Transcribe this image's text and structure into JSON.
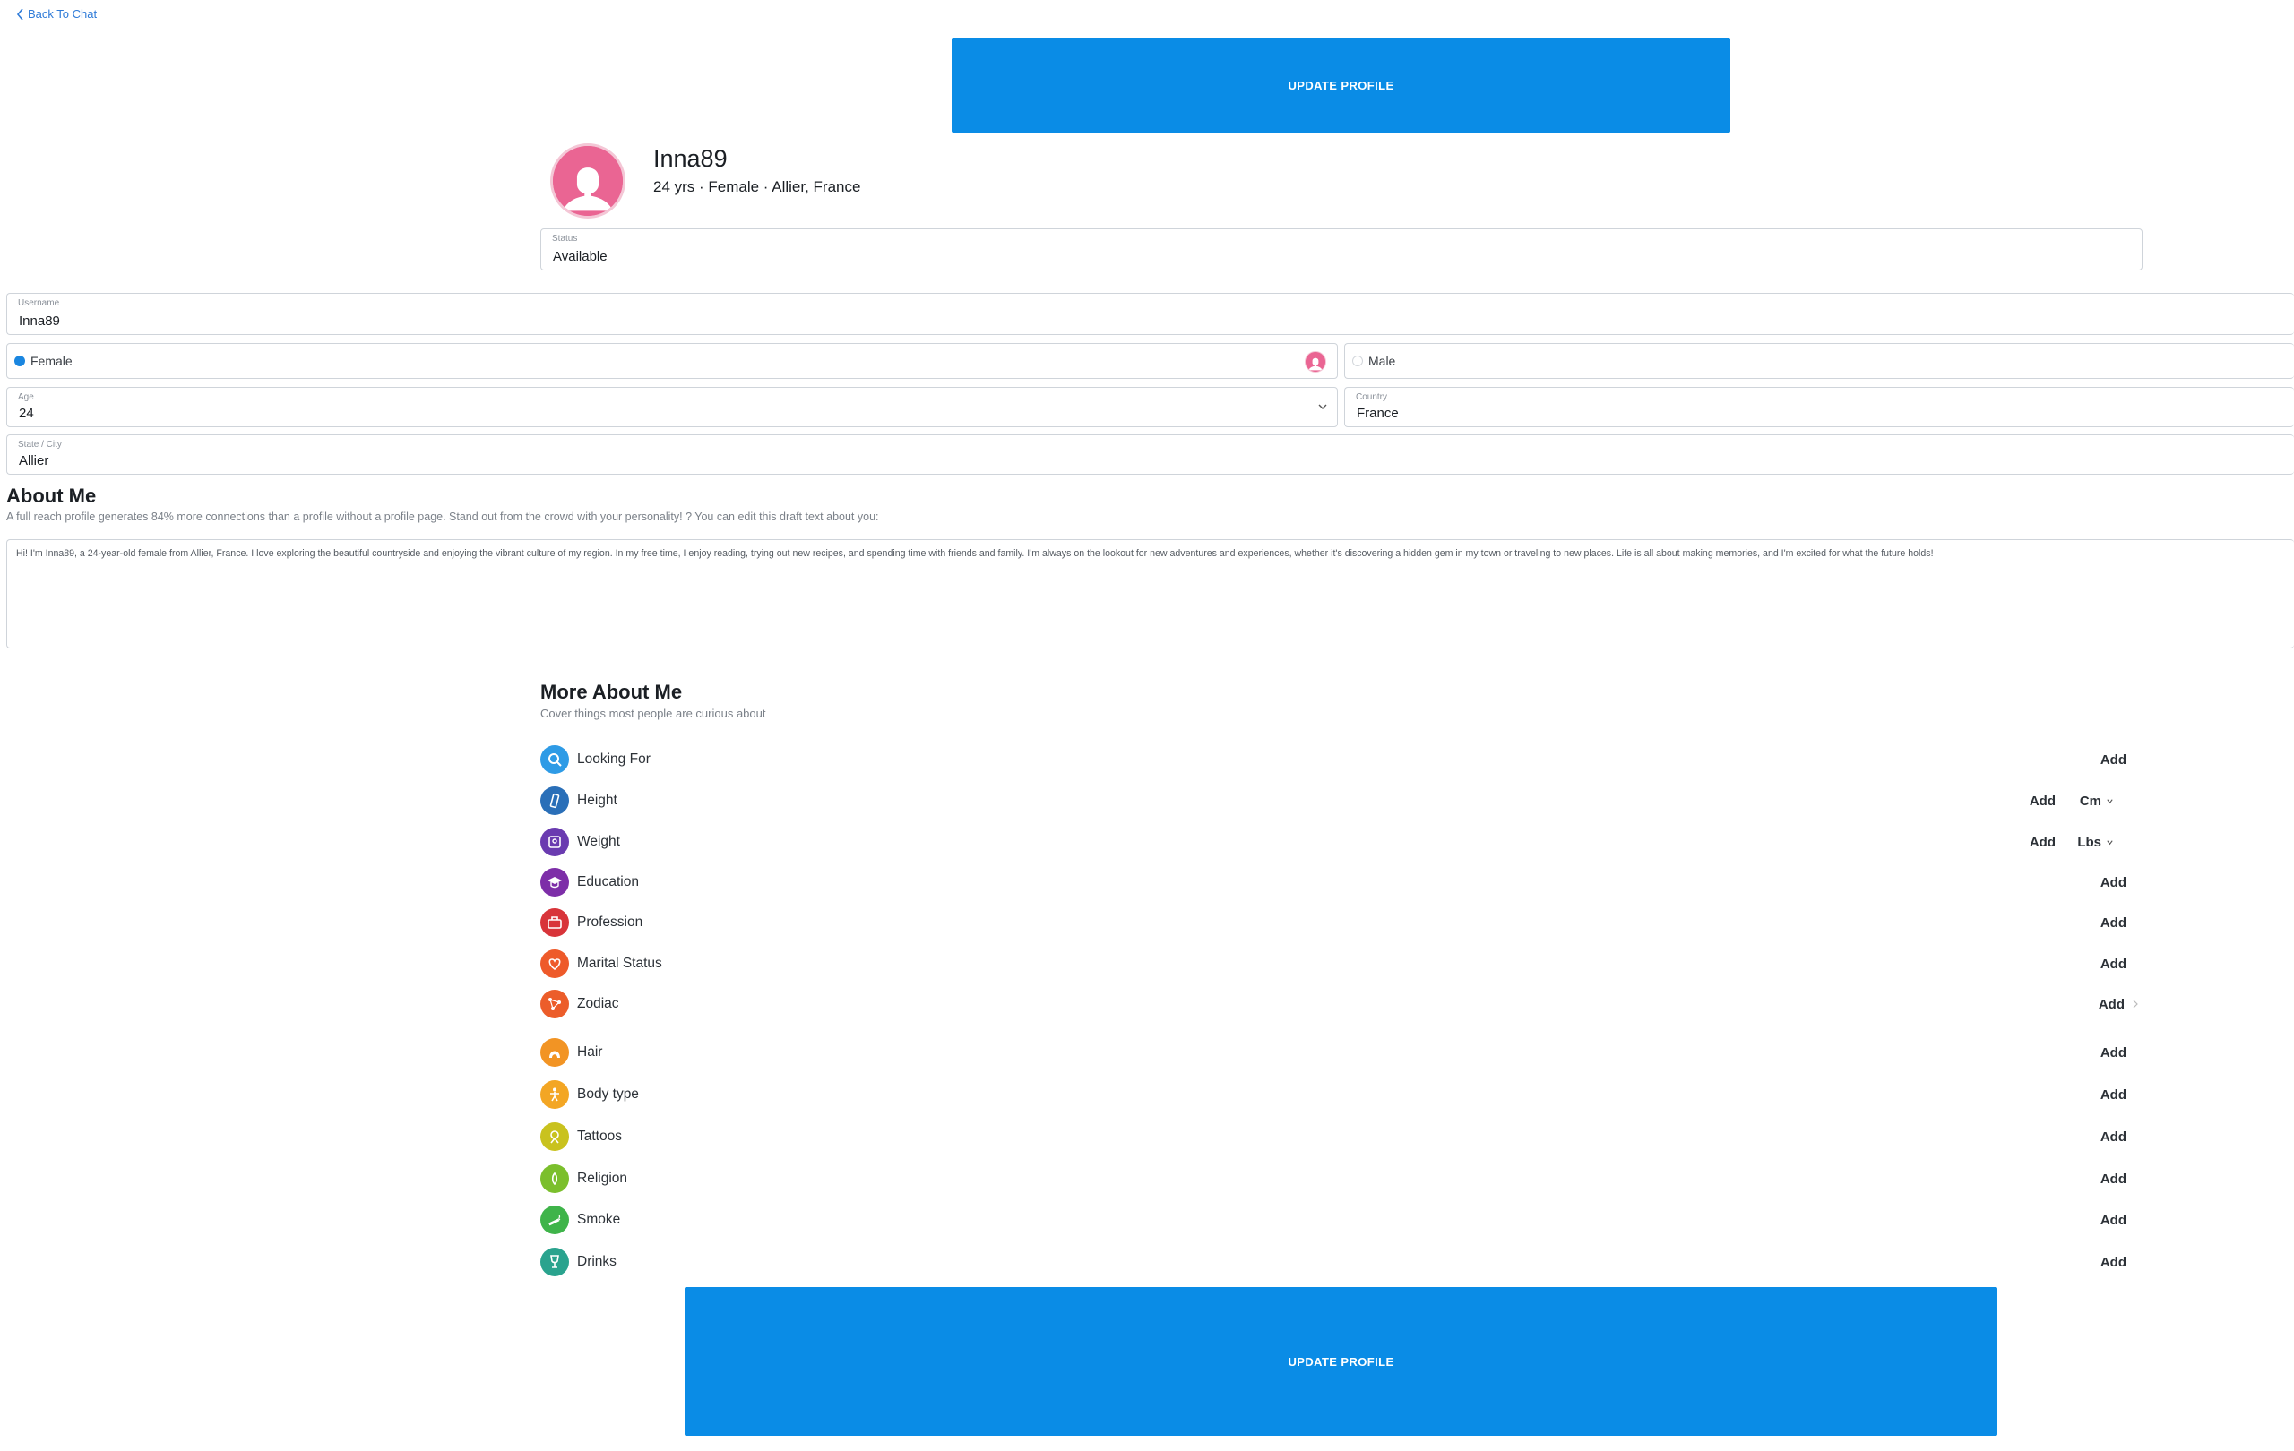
{
  "nav": {
    "back_label": "Back To Chat"
  },
  "actions": {
    "update_top": "UPDATE PROFILE",
    "update_bottom": "UPDATE PROFILE"
  },
  "profile": {
    "username": "Inna89",
    "summary": "24 yrs · Female · Allier, France",
    "avatar_color": "#ea6593"
  },
  "fields": {
    "status": {
      "label": "Status",
      "value": "Available"
    },
    "username": {
      "label": "Username",
      "value": "Inna89"
    },
    "gender": {
      "female": "Female",
      "male": "Male",
      "selected": "Female"
    },
    "age": {
      "label": "Age",
      "value": "24"
    },
    "country": {
      "label": "Country",
      "value": "France"
    },
    "city": {
      "label": "State / City",
      "value": "Allier"
    }
  },
  "about": {
    "title": "About Me",
    "subtitle": "A full reach profile generates 84% more connections than a profile without a profile page. Stand out from the crowd with your personality! ? You can edit this draft text about you:",
    "text": "Hi! I'm Inna89, a 24-year-old female from Allier, France. I love exploring the beautiful countryside and enjoying the vibrant culture of my region. In my free time, I enjoy reading, trying out new recipes, and spending time with friends and family. I'm always on the lookout for new adventures and experiences, whether it's discovering a hidden gem in my town or traveling to new places. Life is all about making memories, and I'm excited for what the future holds!"
  },
  "more": {
    "title": "More About Me",
    "subtitle": "Cover things most people are curious about",
    "add_label": "Add",
    "items": [
      {
        "label": "Looking For",
        "icon": "search-icon",
        "color": "#2e9be6"
      },
      {
        "label": "Height",
        "icon": "ruler-icon",
        "color": "#2a6fb8",
        "unit": "Cm"
      },
      {
        "label": "Weight",
        "icon": "scale-icon",
        "color": "#6a3bb0",
        "unit": "Lbs"
      },
      {
        "label": "Education",
        "icon": "graduation-cap-icon",
        "color": "#7d2ea8"
      },
      {
        "label": "Profession",
        "icon": "briefcase-icon",
        "color": "#d8343a"
      },
      {
        "label": "Marital Status",
        "icon": "heart-icon",
        "color": "#ee5a2a"
      },
      {
        "label": "Zodiac",
        "icon": "constellation-icon",
        "color": "#ec5d2a"
      },
      {
        "label": "Hair",
        "icon": "hair-icon",
        "color": "#f29424"
      },
      {
        "label": "Body type",
        "icon": "body-icon",
        "color": "#f3a624"
      },
      {
        "label": "Tattoos",
        "icon": "tattoo-icon",
        "color": "#c9c21e"
      },
      {
        "label": "Religion",
        "icon": "praying-hands-icon",
        "color": "#7bbf2c"
      },
      {
        "label": "Smoke",
        "icon": "cigarette-icon",
        "color": "#3fb44a"
      },
      {
        "label": "Drinks",
        "icon": "wine-glass-icon",
        "color": "#2aa38e"
      }
    ]
  }
}
